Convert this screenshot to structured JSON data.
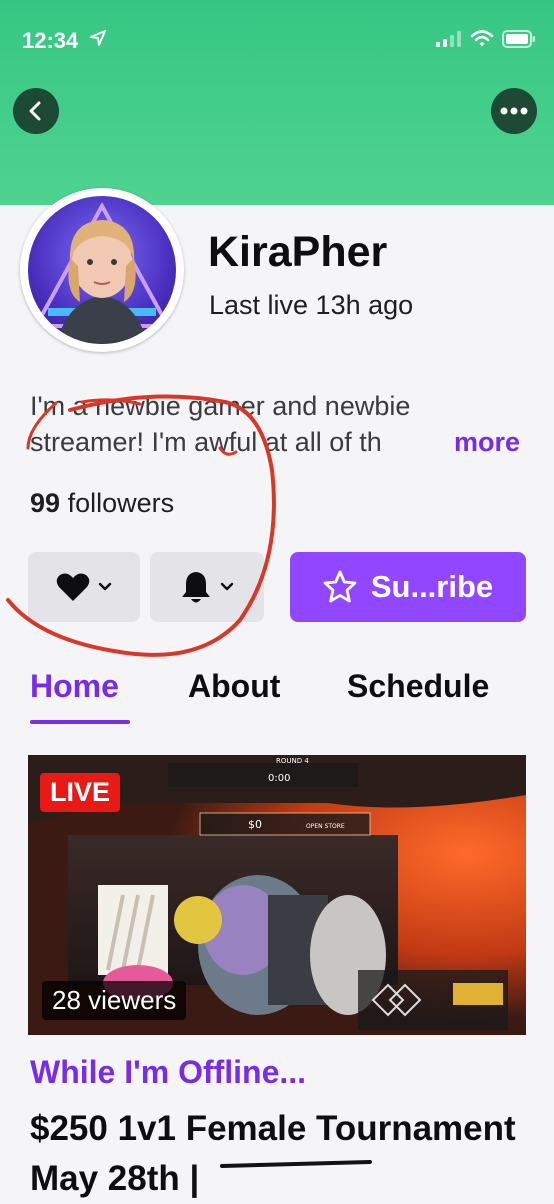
{
  "status_bar": {
    "time": "12:34"
  },
  "profile": {
    "name": "KiraPher",
    "last_live": "Last live 13h ago",
    "bio_line1": "I'm a newbie gamer and newbie",
    "bio_line2": "streamer! I'm awful at all of th",
    "more_label": "more",
    "followers_count": "99",
    "followers_label": "followers"
  },
  "actions": {
    "subscribe_label": "Su...ribe"
  },
  "tabs": [
    {
      "label": "Home",
      "active": true
    },
    {
      "label": "About",
      "active": false
    },
    {
      "label": "Schedule",
      "active": false
    }
  ],
  "video": {
    "live_label": "LIVE",
    "viewers": "28 viewers",
    "hud_round": "ROUND 4",
    "hud_timer": "0:00",
    "hud_money": "$0",
    "hud_store": "OPEN STORE"
  },
  "stream": {
    "category": "While I'm Offline...",
    "title": "$250 1v1 Female Tournament May 28th |"
  },
  "colors": {
    "header_green": "#45cf8b",
    "accent_purple": "#9147ff",
    "live_red": "#e91916",
    "annotation_red": "#d8382a"
  }
}
